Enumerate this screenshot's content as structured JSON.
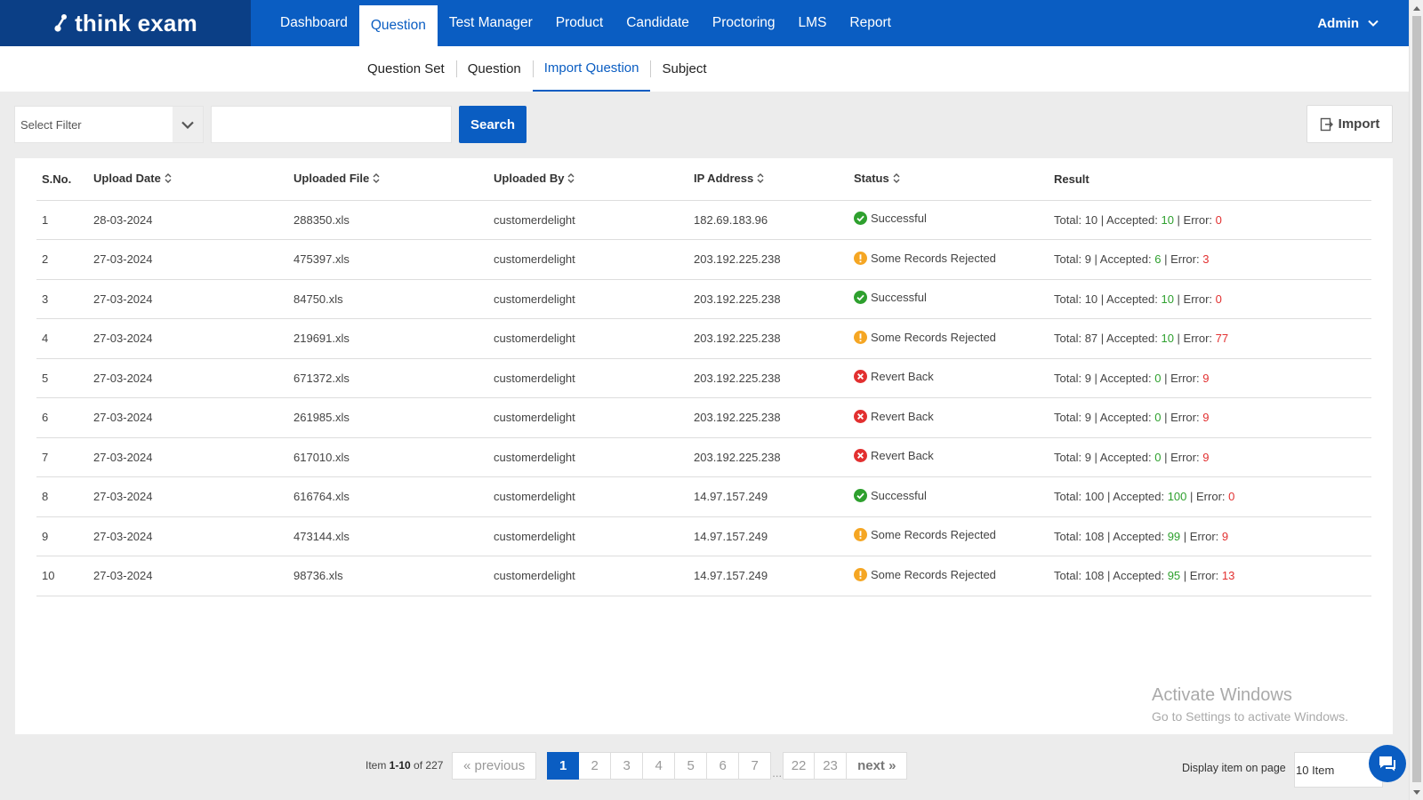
{
  "brand": {
    "name": "think exam"
  },
  "nav": {
    "items": [
      {
        "label": "Dashboard"
      },
      {
        "label": "Question"
      },
      {
        "label": "Test Manager"
      },
      {
        "label": "Product"
      },
      {
        "label": "Candidate"
      },
      {
        "label": "Proctoring"
      },
      {
        "label": "LMS"
      },
      {
        "label": "Report"
      }
    ],
    "active": "Question",
    "user": "Admin"
  },
  "subnav": {
    "items": [
      {
        "label": "Question Set"
      },
      {
        "label": "Question"
      },
      {
        "label": "Import Question"
      },
      {
        "label": "Subject"
      }
    ],
    "active": "Import Question"
  },
  "toolbar": {
    "filter_placeholder": "Select Filter",
    "search_value": "",
    "search_label": "Search",
    "import_label": "Import"
  },
  "table": {
    "headers": {
      "sno": "S.No.",
      "date": "Upload Date",
      "file": "Uploaded File",
      "by": "Uploaded By",
      "ip": "IP Address",
      "status": "Status",
      "result": "Result"
    },
    "result_labels": {
      "total": "Total: ",
      "accepted": " | Accepted: ",
      "error": " | Error: "
    },
    "rows": [
      {
        "sno": "1",
        "date": "28-03-2024",
        "file": "288350.xls",
        "by": "customerdelight",
        "ip": "182.69.183.96",
        "status": "Successful",
        "status_type": "success",
        "total": "10",
        "accepted": "10",
        "error": "0"
      },
      {
        "sno": "2",
        "date": "27-03-2024",
        "file": "475397.xls",
        "by": "customerdelight",
        "ip": "203.192.225.238",
        "status": "Some Records Rejected",
        "status_type": "warning",
        "total": "9",
        "accepted": "6",
        "error": "3"
      },
      {
        "sno": "3",
        "date": "27-03-2024",
        "file": "84750.xls",
        "by": "customerdelight",
        "ip": "203.192.225.238",
        "status": "Successful",
        "status_type": "success",
        "total": "10",
        "accepted": "10",
        "error": "0"
      },
      {
        "sno": "4",
        "date": "27-03-2024",
        "file": "219691.xls",
        "by": "customerdelight",
        "ip": "203.192.225.238",
        "status": "Some Records Rejected",
        "status_type": "warning",
        "total": "87",
        "accepted": "10",
        "error": "77"
      },
      {
        "sno": "5",
        "date": "27-03-2024",
        "file": "671372.xls",
        "by": "customerdelight",
        "ip": "203.192.225.238",
        "status": "Revert Back",
        "status_type": "error",
        "total": "9",
        "accepted": "0",
        "error": "9"
      },
      {
        "sno": "6",
        "date": "27-03-2024",
        "file": "261985.xls",
        "by": "customerdelight",
        "ip": "203.192.225.238",
        "status": "Revert Back",
        "status_type": "error",
        "total": "9",
        "accepted": "0",
        "error": "9"
      },
      {
        "sno": "7",
        "date": "27-03-2024",
        "file": "617010.xls",
        "by": "customerdelight",
        "ip": "203.192.225.238",
        "status": "Revert Back",
        "status_type": "error",
        "total": "9",
        "accepted": "0",
        "error": "9"
      },
      {
        "sno": "8",
        "date": "27-03-2024",
        "file": "616764.xls",
        "by": "customerdelight",
        "ip": "14.97.157.249",
        "status": "Successful",
        "status_type": "success",
        "total": "100",
        "accepted": "100",
        "error": "0"
      },
      {
        "sno": "9",
        "date": "27-03-2024",
        "file": "473144.xls",
        "by": "customerdelight",
        "ip": "14.97.157.249",
        "status": "Some Records Rejected",
        "status_type": "warning",
        "total": "108",
        "accepted": "99",
        "error": "9"
      },
      {
        "sno": "10",
        "date": "27-03-2024",
        "file": "98736.xls",
        "by": "customerdelight",
        "ip": "14.97.157.249",
        "status": "Some Records Rejected",
        "status_type": "warning",
        "total": "108",
        "accepted": "95",
        "error": "13"
      }
    ]
  },
  "watermark": {
    "line1": "Activate Windows",
    "line2": "Go to Settings to activate Windows."
  },
  "pagination": {
    "prefix": "Item ",
    "range": "1-10",
    "of_label": " of ",
    "total": "227",
    "previous_label": "« previous",
    "pages": [
      "1",
      "2",
      "3",
      "4",
      "5",
      "6",
      "7"
    ],
    "ellipsis": "...",
    "tail_pages": [
      "22",
      "23"
    ],
    "next_label": "next »",
    "current": "1"
  },
  "page_size": {
    "label": "Display item on page",
    "value": "10 Item"
  },
  "colors": {
    "brand_dark": "#0b3f86",
    "primary": "#0a5dc2",
    "success": "#2ea02e",
    "warning": "#f5a623",
    "error": "#e23030"
  }
}
